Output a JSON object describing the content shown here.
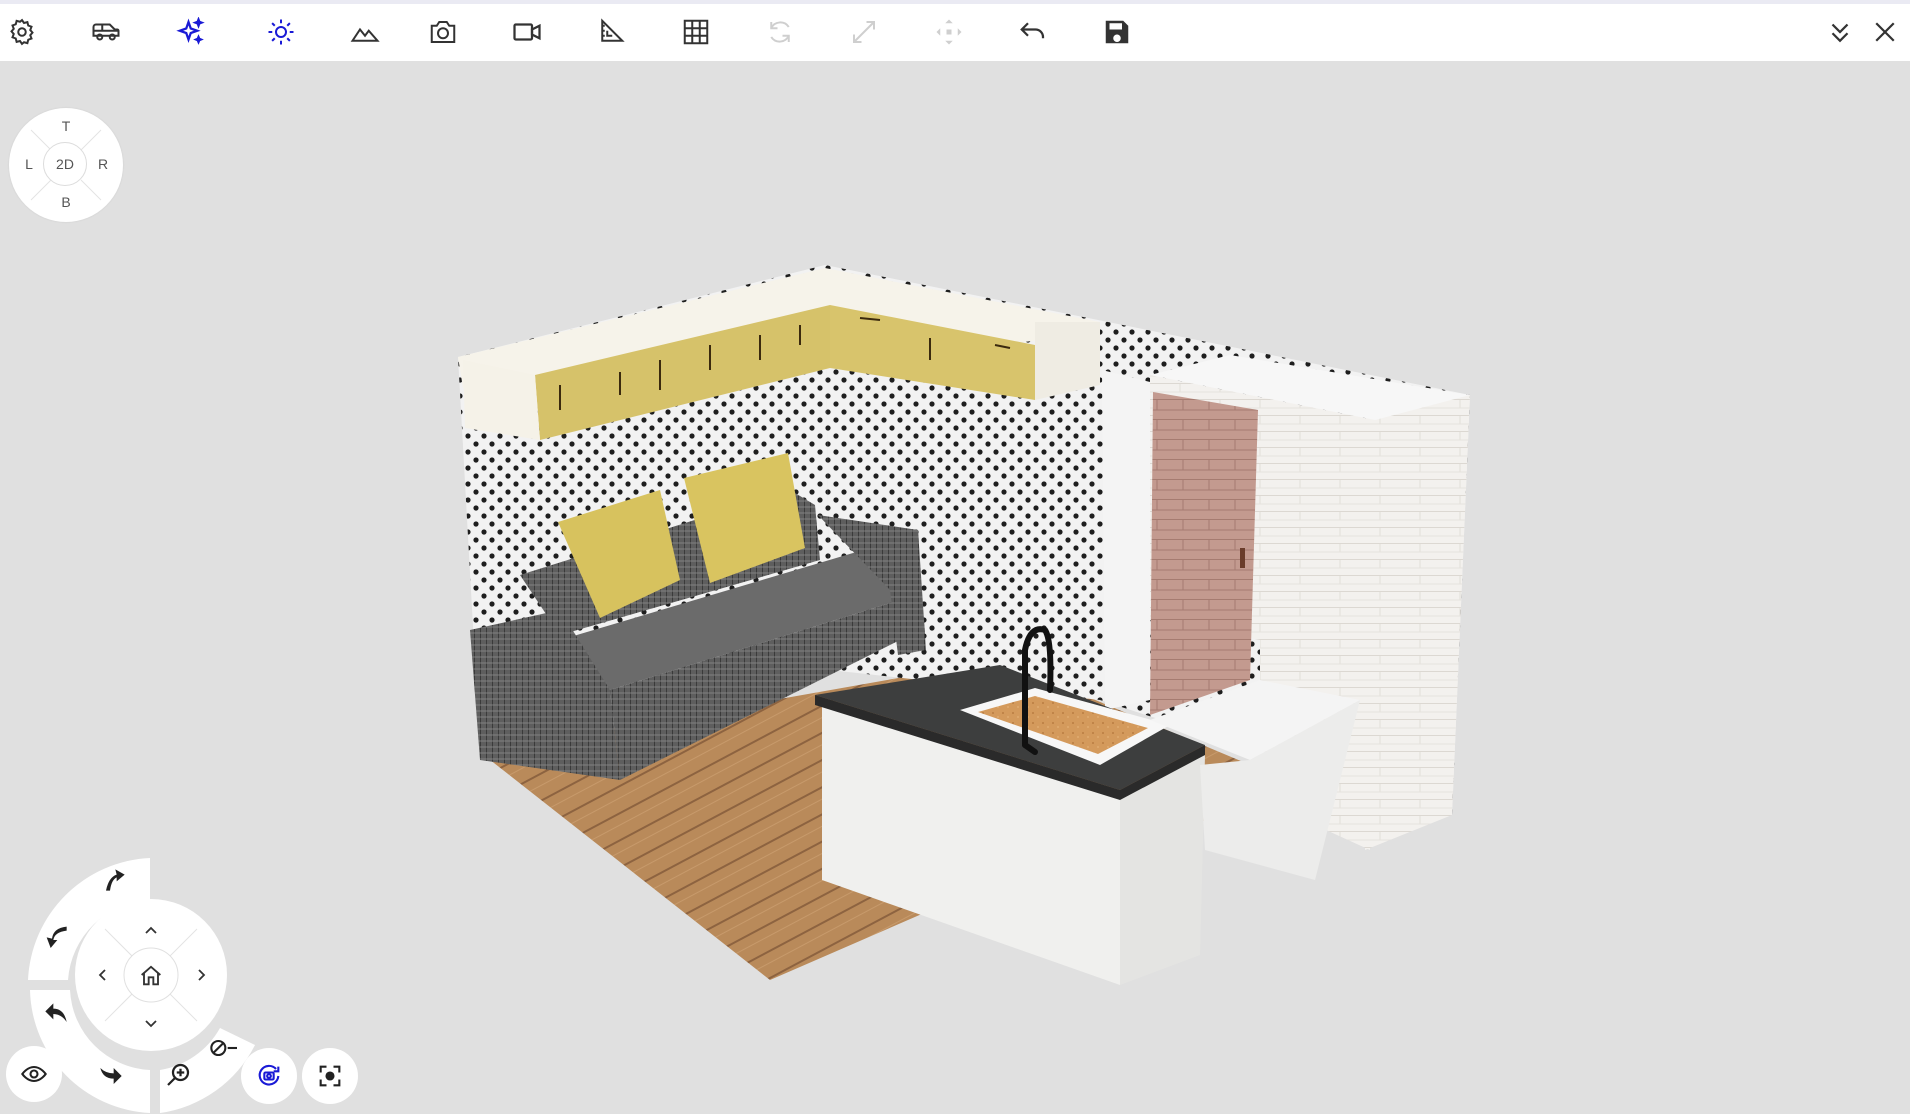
{
  "toolbar": {
    "buttons": [
      {
        "name": "settings",
        "icon": "gear-icon",
        "state": "normal"
      },
      {
        "name": "vehicle",
        "icon": "van-icon",
        "state": "normal"
      },
      {
        "name": "effects",
        "icon": "sparkle-icon",
        "state": "active"
      },
      {
        "name": "lighting",
        "icon": "sun-icon",
        "state": "active"
      },
      {
        "name": "terrain",
        "icon": "mountain-icon",
        "state": "normal"
      },
      {
        "name": "screenshot",
        "icon": "camera-icon",
        "state": "normal"
      },
      {
        "name": "video",
        "icon": "video-camera-icon",
        "state": "normal"
      },
      {
        "name": "measure",
        "icon": "ruler-triangle-icon",
        "state": "normal"
      },
      {
        "name": "grid",
        "icon": "grid-icon",
        "state": "normal"
      },
      {
        "name": "rotate",
        "icon": "rotate-icon",
        "state": "disabled"
      },
      {
        "name": "resize",
        "icon": "resize-icon",
        "state": "disabled"
      },
      {
        "name": "move",
        "icon": "move-icon",
        "state": "disabled"
      },
      {
        "name": "undo",
        "icon": "undo-icon",
        "state": "normal"
      },
      {
        "name": "save",
        "icon": "save-icon",
        "state": "normal"
      }
    ],
    "right_buttons": [
      {
        "name": "collapse",
        "icon": "double-chevron-down-icon"
      },
      {
        "name": "close",
        "icon": "close-icon"
      }
    ]
  },
  "viewcube": {
    "top": "T",
    "left": "L",
    "center": "2D",
    "right": "R",
    "bottom": "B"
  },
  "nav": {
    "icons": [
      "arrow-up-curved-icon",
      "arrow-left-curved-icon",
      "undo-arrow-icon",
      "redo-arrow-icon",
      "zoom-in-icon",
      "zoom-out-icon",
      "chevron-up-icon",
      "chevron-down-icon",
      "chevron-left-icon",
      "chevron-right-icon",
      "home-icon",
      "eye-icon",
      "orbit-icon",
      "focus-icon"
    ]
  },
  "colors": {
    "active": "#1a1ad6",
    "normal": "#333333",
    "disabled": "#cfcfcf",
    "background": "#e0e0e0"
  }
}
